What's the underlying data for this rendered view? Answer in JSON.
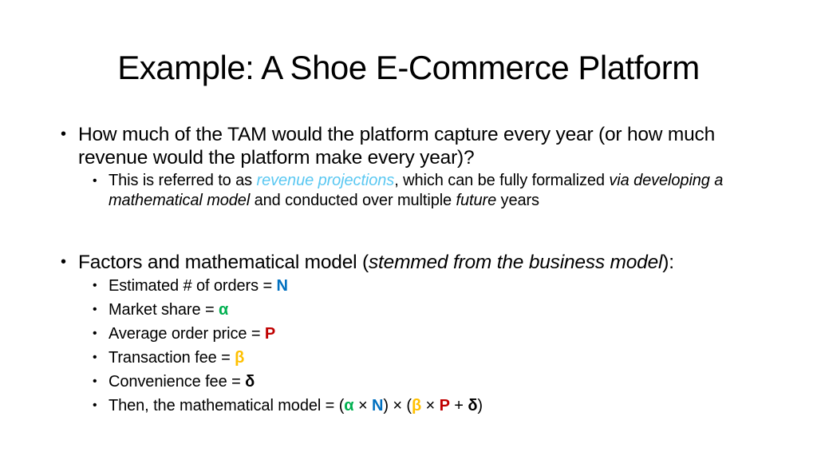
{
  "title": "Example: A Shoe E-Commerce Platform",
  "colors": {
    "revenue_projections": "#5BC8F2",
    "alpha": "#00B050",
    "N": "#0070C0",
    "beta": "#FFC000",
    "P": "#C00000",
    "delta": "#000000"
  },
  "bullets": {
    "first": {
      "text": "How much of the TAM would the platform capture every year (or how much revenue would the platform make every year)?",
      "sub": {
        "prefix": "This is referred to as ",
        "highlight": "revenue projections",
        "middle": ", which can be fully formalized ",
        "italic1": "via developing a mathematical model",
        "middle2": " and conducted over multiple ",
        "italic2": "future",
        "suffix": " years"
      }
    },
    "second": {
      "prefix": "Factors and mathematical model (",
      "italic": "stemmed from the business model",
      "suffix": "):",
      "items": [
        {
          "label": "Estimated # of orders = ",
          "symbol": "N"
        },
        {
          "label": "Market share = ",
          "symbol": "α"
        },
        {
          "label": "Average order price = ",
          "symbol": "P"
        },
        {
          "label": "Transaction fee = ",
          "symbol": "β"
        },
        {
          "label": "Convenience fee = ",
          "symbol": "δ"
        }
      ],
      "model": {
        "label": "Then, the mathematical model = ",
        "open1": "(",
        "alpha": "α",
        "times1": " × ",
        "N": "N",
        "close1": ") × (",
        "beta": "β",
        "times2": " × ",
        "P": "P",
        "plus": " + ",
        "delta": "δ",
        "close2": ")"
      }
    }
  },
  "bullet_glyph": "•"
}
